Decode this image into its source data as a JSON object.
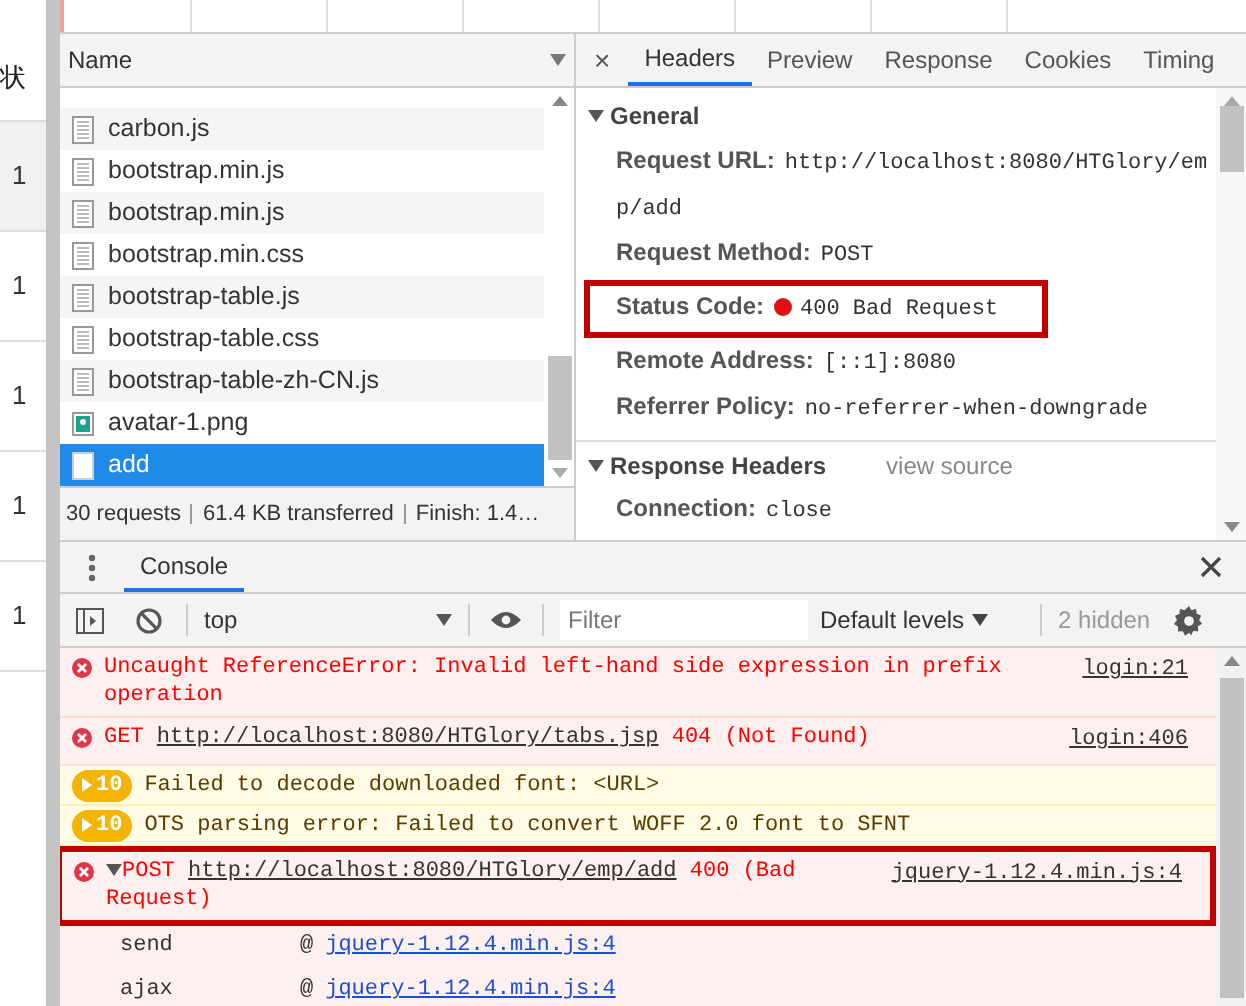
{
  "background_page": {
    "header": "状",
    "cells": [
      "1",
      "1",
      "1",
      "1",
      "1"
    ]
  },
  "network": {
    "name_column": "Name",
    "requests": [
      {
        "name": "carbon.js",
        "kind": "script",
        "selected": false
      },
      {
        "name": "bootstrap.min.js",
        "kind": "script",
        "selected": false
      },
      {
        "name": "bootstrap.min.js",
        "kind": "script",
        "selected": false
      },
      {
        "name": "bootstrap.min.css",
        "kind": "script",
        "selected": false
      },
      {
        "name": "bootstrap-table.js",
        "kind": "script",
        "selected": false
      },
      {
        "name": "bootstrap-table.css",
        "kind": "script",
        "selected": false
      },
      {
        "name": "bootstrap-table-zh-CN.js",
        "kind": "script",
        "selected": false
      },
      {
        "name": "avatar-1.png",
        "kind": "image",
        "selected": false
      },
      {
        "name": "add",
        "kind": "document",
        "selected": true
      }
    ],
    "summary": [
      "30 requests",
      "61.4 KB transferred",
      "Finish: 1.4…"
    ]
  },
  "details": {
    "close": "×",
    "tabs": [
      {
        "label": "Headers",
        "selected": true
      },
      {
        "label": "Preview",
        "selected": false
      },
      {
        "label": "Response",
        "selected": false
      },
      {
        "label": "Cookies",
        "selected": false
      },
      {
        "label": "Timing",
        "selected": false
      }
    ],
    "sections": [
      {
        "title": "General",
        "expanded": true,
        "rows": [
          {
            "label": "Request URL:",
            "value": "http://localhost:8080/HTGlory/emp/add",
            "highlighted": false
          },
          {
            "label": "Request Method:",
            "value": "POST",
            "highlighted": false
          },
          {
            "label": "Status Code:",
            "value": "400 Bad Request",
            "highlighted": true
          },
          {
            "label": "Remote Address:",
            "value": "[::1]:8080",
            "highlighted": false
          },
          {
            "label": "Referrer Policy:",
            "value": "no-referrer-when-downgrade",
            "highlighted": false
          }
        ]
      },
      {
        "title": "Response Headers",
        "expanded": true,
        "link": "view source",
        "rows": [
          {
            "label": "Connection:",
            "value": "close",
            "highlighted": false
          }
        ]
      }
    ]
  },
  "console": {
    "tab": "Console",
    "context": "top",
    "filter_placeholder": "Filter",
    "levels": "Default levels",
    "hidden": "2 hidden",
    "messages": [
      {
        "kind": "error",
        "text": "Uncaught ReferenceError: Invalid left-hand side expression in prefix operation",
        "source": "login:21",
        "highlighted": false
      },
      {
        "kind": "request",
        "method": "GET",
        "url": "http://localhost:8080/HTGlory/tabs.jsp",
        "status": "404 (Not Found)",
        "source": "login:406",
        "highlighted": false
      },
      {
        "kind": "warning",
        "count": "10",
        "text": "Failed to decode downloaded font: <URL>"
      },
      {
        "kind": "warning",
        "count": "10",
        "text": "OTS parsing error: Failed to convert WOFF 2.0 font to SFNT"
      },
      {
        "kind": "request",
        "method": "POST",
        "url": "http://localhost:8080/HTGlory/emp/add",
        "status": "400 (Bad Request)",
        "source": "jquery-1.12.4.min.js:4",
        "highlighted": true,
        "expanded": true,
        "stack": [
          {
            "function": "send",
            "at": "@",
            "source": "jquery-1.12.4.min.js:4"
          },
          {
            "function": "ajax",
            "at": "@",
            "source": "jquery-1.12.4.min.js:4"
          }
        ]
      }
    ]
  }
}
